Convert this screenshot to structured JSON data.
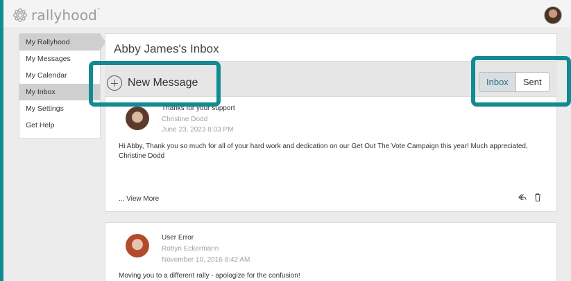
{
  "app": {
    "logo_text": "rallyhood",
    "logo_tm": "°"
  },
  "sidebar": {
    "items": [
      {
        "label": "My Rallyhood"
      },
      {
        "label": "My Messages"
      },
      {
        "label": "My Calendar"
      },
      {
        "label": "My Inbox"
      },
      {
        "label": "My Settings"
      },
      {
        "label": "Get Help"
      }
    ]
  },
  "main": {
    "title": "Abby James's Inbox",
    "new_message_label": "New Message",
    "tabs": [
      {
        "label": "Inbox"
      },
      {
        "label": "Sent"
      }
    ]
  },
  "messages": [
    {
      "subject": "Thanks for your support",
      "sender": "Christine Dodd",
      "date": "June 23, 2023 8:03 PM",
      "body_line1": "Hi Abby, Thank you so much for all of your hard work and dedication on our Get Out The Vote Campaign this year! Much appreciated,",
      "body_line2": "Christine Dodd",
      "view_more": "... View More"
    },
    {
      "subject": "User Error",
      "sender": "Robyn Eckermann",
      "date": "November 10, 2016 8:42 AM",
      "body_line1": "Moving you to a different rally - apologize for the confusion!"
    }
  ],
  "colors": {
    "highlight": "#128a92",
    "selected_tab_text": "#2a6f85"
  }
}
